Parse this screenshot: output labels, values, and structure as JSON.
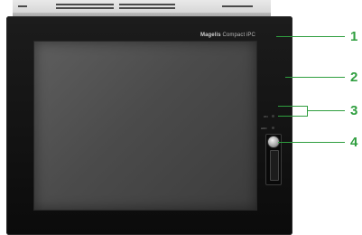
{
  "device": {
    "brand_bold": "Magelis",
    "brand_rest": "Compact iPC"
  },
  "callouts": [
    "1",
    "2",
    "3",
    "4"
  ],
  "colors": {
    "callout": "#2f9e3f",
    "bezel": "#111111",
    "screen": "#4f4f4f"
  }
}
